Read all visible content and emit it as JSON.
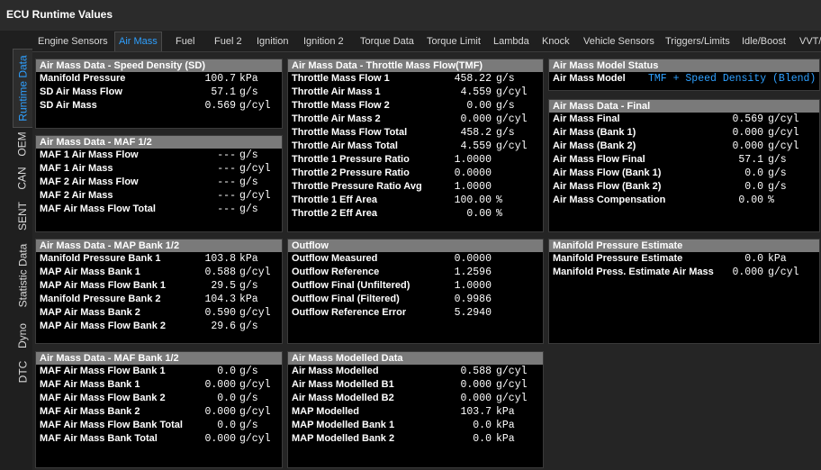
{
  "window": {
    "title": "ECU Runtime Values"
  },
  "tabs": [
    "Engine Sensors",
    "Air Mass",
    "Fuel",
    "Fuel 2",
    "Ignition",
    "Ignition 2",
    "Torque Data",
    "Torque Limit",
    "Lambda",
    "Knock",
    "Vehicle Sensors",
    "Triggers/Limits",
    "Idle/Boost",
    "VVT/"
  ],
  "active_tab": "Air Mass",
  "side_tabs": [
    "Runtime Data",
    "OEM",
    "CAN",
    "SENT",
    "Statistic Data",
    "Dyno",
    "DTC"
  ],
  "active_side_tab": "Runtime Data",
  "panels": {
    "sd": {
      "title": "Air Mass Data - Speed Density (SD)",
      "rows": [
        {
          "label": "Manifold Pressure",
          "value": "100.7",
          "unit": "kPa"
        },
        {
          "label": "SD Air Mass Flow",
          "value": "57.1",
          "unit": "g/s"
        },
        {
          "label": "SD Air Mass",
          "value": "0.569",
          "unit": "g/cyl"
        }
      ]
    },
    "maf": {
      "title": "Air Mass Data - MAF 1/2",
      "rows": [
        {
          "label": "MAF 1 Air Mass Flow",
          "value": "---",
          "unit": "g/s"
        },
        {
          "label": "MAF 1 Air Mass",
          "value": "---",
          "unit": "g/cyl"
        },
        {
          "label": "MAF 2 Air Mass Flow",
          "value": "---",
          "unit": "g/s"
        },
        {
          "label": "MAF 2 Air Mass",
          "value": "---",
          "unit": "g/cyl"
        },
        {
          "label": "MAF Air Mass Flow Total",
          "value": "---",
          "unit": "g/s"
        }
      ]
    },
    "map_bank": {
      "title": "Air Mass Data - MAP Bank 1/2",
      "rows": [
        {
          "label": "Manifold Pressure Bank 1",
          "value": "103.8",
          "unit": "kPa"
        },
        {
          "label": "MAP Air Mass Bank 1",
          "value": "0.588",
          "unit": "g/cyl"
        },
        {
          "label": "MAP Air Mass Flow Bank 1",
          "value": "29.5",
          "unit": "g/s"
        },
        {
          "label": "Manifold Pressure Bank 2",
          "value": "104.3",
          "unit": "kPa"
        },
        {
          "label": "MAP Air Mass Bank 2",
          "value": "0.590",
          "unit": "g/cyl"
        },
        {
          "label": "MAP Air Mass Flow Bank 2",
          "value": "29.6",
          "unit": "g/s"
        }
      ]
    },
    "maf_bank": {
      "title": "Air Mass Data - MAF Bank 1/2",
      "rows": [
        {
          "label": "MAF Air Mass Flow Bank 1",
          "value": "0.0",
          "unit": "g/s"
        },
        {
          "label": "MAF Air Mass Bank 1",
          "value": "0.000",
          "unit": "g/cyl"
        },
        {
          "label": "MAF Air Mass Flow Bank 2",
          "value": "0.0",
          "unit": "g/s"
        },
        {
          "label": "MAF Air Mass Bank 2",
          "value": "0.000",
          "unit": "g/cyl"
        },
        {
          "label": "MAF Air Mass Flow Bank Total",
          "value": "0.0",
          "unit": "g/s"
        },
        {
          "label": "MAF Air Mass Bank Total",
          "value": "0.000",
          "unit": "g/cyl"
        }
      ]
    },
    "tmf": {
      "title": "Air Mass Data - Throttle Mass Flow(TMF)",
      "rows": [
        {
          "label": "Throttle Mass Flow 1",
          "value": "458.22",
          "unit": "g/s"
        },
        {
          "label": "Throttle Air Mass 1",
          "value": "4.559",
          "unit": "g/cyl"
        },
        {
          "label": "Throttle Mass Flow 2",
          "value": "0.00",
          "unit": "g/s"
        },
        {
          "label": "Throttle Air Mass 2",
          "value": "0.000",
          "unit": "g/cyl"
        },
        {
          "label": "Throttle Mass Flow Total",
          "value": "458.2",
          "unit": "g/s"
        },
        {
          "label": "Throttle Air Mass Total",
          "value": "4.559",
          "unit": "g/cyl"
        },
        {
          "label": "Throttle 1 Pressure Ratio",
          "value": "1.0000",
          "unit": ""
        },
        {
          "label": "Throttle 2 Pressure Ratio",
          "value": "0.0000",
          "unit": ""
        },
        {
          "label": "Throttle Pressure Ratio Avg",
          "value": "1.0000",
          "unit": ""
        },
        {
          "label": "Throttle 1 Eff Area",
          "value": "100.00",
          "unit": "%"
        },
        {
          "label": "Throttle 2 Eff Area",
          "value": "0.00",
          "unit": "%"
        }
      ]
    },
    "outflow": {
      "title": "Outflow",
      "rows": [
        {
          "label": "Outflow Measured",
          "value": "0.0000",
          "unit": ""
        },
        {
          "label": "Outflow Reference",
          "value": "1.2596",
          "unit": ""
        },
        {
          "label": "Outflow Final (Unfiltered)",
          "value": "1.0000",
          "unit": ""
        },
        {
          "label": "Outflow Final (Filtered)",
          "value": "0.9986",
          "unit": ""
        },
        {
          "label": "Outflow Reference Error",
          "value": "5.2940",
          "unit": ""
        }
      ]
    },
    "modelled": {
      "title": "Air Mass Modelled Data",
      "rows": [
        {
          "label": "Air Mass Modelled",
          "value": "0.588",
          "unit": "g/cyl"
        },
        {
          "label": "Air Mass Modelled B1",
          "value": "0.000",
          "unit": "g/cyl"
        },
        {
          "label": "Air Mass Modelled B2",
          "value": "0.000",
          "unit": "g/cyl"
        },
        {
          "label": "MAP Modelled",
          "value": "103.7",
          "unit": "kPa"
        },
        {
          "label": "MAP Modelled Bank 1",
          "value": "0.0",
          "unit": "kPa"
        },
        {
          "label": "MAP Modelled Bank 2",
          "value": "0.0",
          "unit": "kPa"
        }
      ]
    },
    "model_status": {
      "title": "Air Mass Model Status",
      "label": "Air Mass Model",
      "value": "TMF + Speed Density (Blend)"
    },
    "final": {
      "title": "Air Mass Data - Final",
      "rows": [
        {
          "label": "Air Mass Final",
          "value": "0.569",
          "unit": "g/cyl"
        },
        {
          "label": "Air Mass (Bank 1)",
          "value": "0.000",
          "unit": "g/cyl"
        },
        {
          "label": "Air Mass (Bank 2)",
          "value": "0.000",
          "unit": "g/cyl"
        },
        {
          "label": "Air Mass Flow Final",
          "value": "57.1",
          "unit": "g/s"
        },
        {
          "label": "Air Mass Flow (Bank 1)",
          "value": "0.0",
          "unit": "g/s"
        },
        {
          "label": "Air Mass Flow (Bank 2)",
          "value": "0.0",
          "unit": "g/s"
        },
        {
          "label": "Air Mass Compensation",
          "value": "0.00",
          "unit": "%"
        }
      ]
    },
    "mp_estimate": {
      "title": "Manifold Pressure Estimate",
      "rows": [
        {
          "label": "Manifold Pressure Estimate",
          "value": "0.0",
          "unit": "kPa"
        },
        {
          "label": "Manifold Press. Estimate Air Mass",
          "value": "0.000",
          "unit": "g/cyl"
        }
      ]
    }
  }
}
